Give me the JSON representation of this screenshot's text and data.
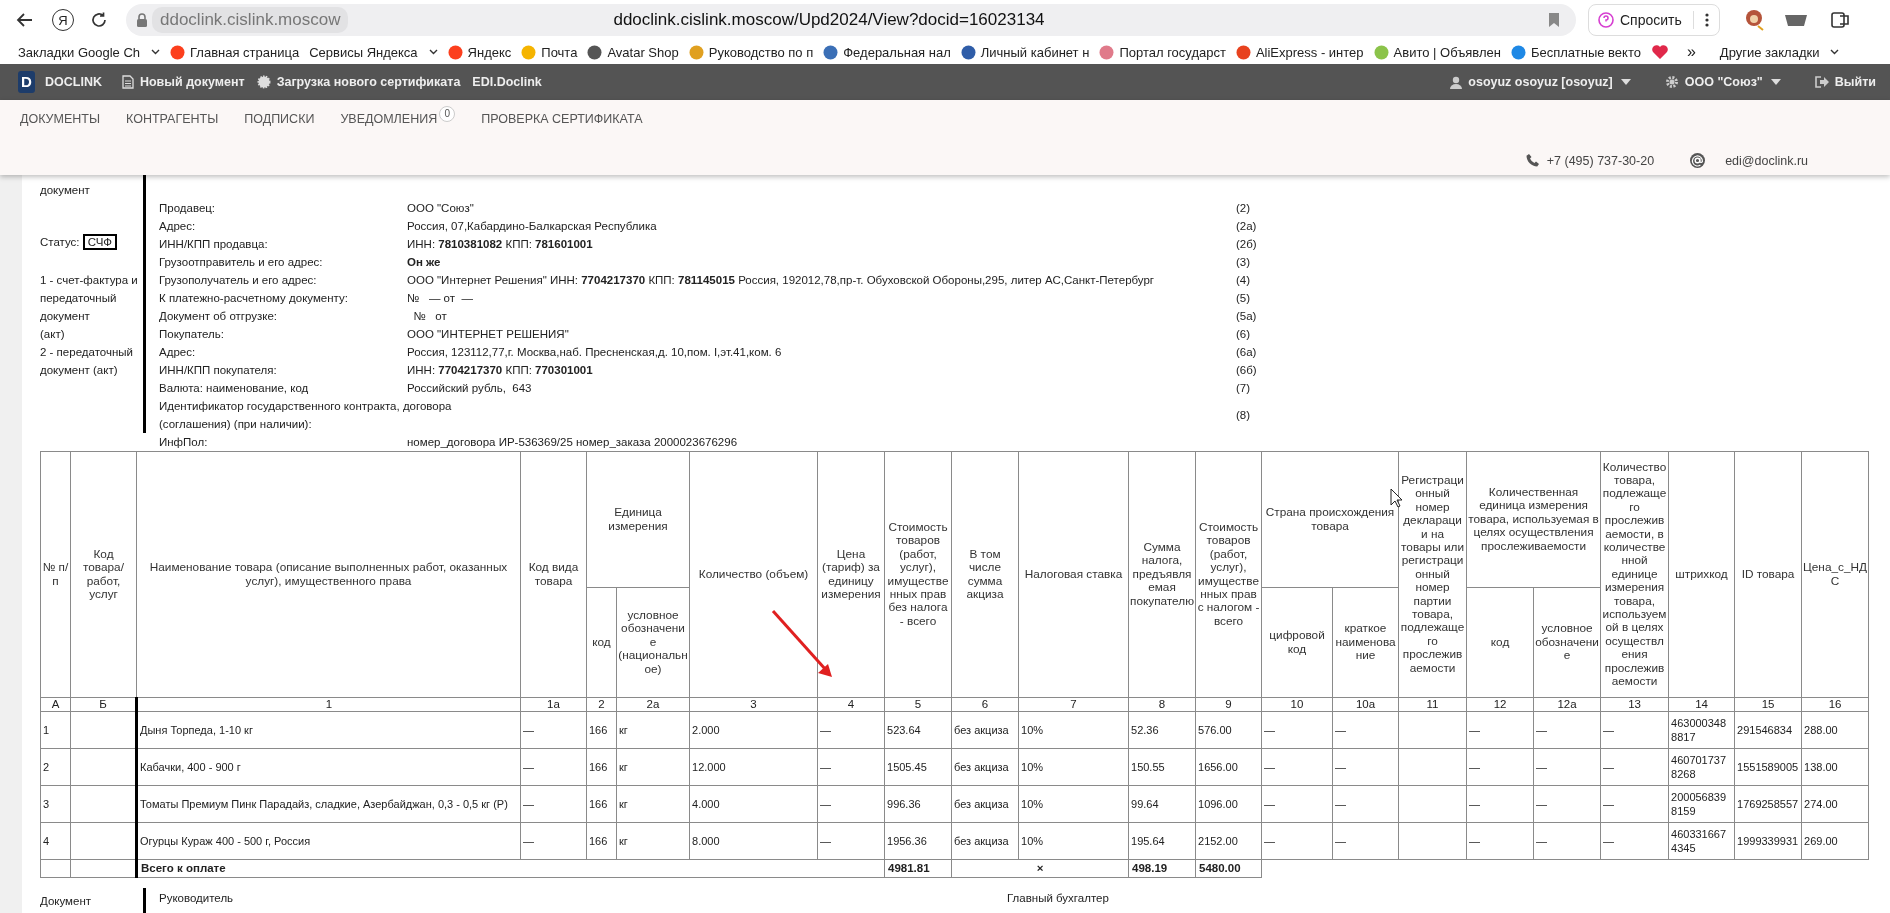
{
  "browser": {
    "yandex_button": "Я",
    "site_chip": "ddoclink.cislink.moscow",
    "url": "ddoclink.cislink.moscow/Upd2024/View?docid=16023134",
    "ask_button": "Спросить",
    "bookmarks": [
      {
        "kind": "menu",
        "label": "Закладки Google Ch"
      },
      {
        "kind": "site",
        "label": "Главная страница",
        "color": "#fc3f1d"
      },
      {
        "kind": "menu",
        "label": "Сервисы Яндекса"
      },
      {
        "kind": "site",
        "label": "Яндекс",
        "color": "#fc3f1d"
      },
      {
        "kind": "site",
        "label": "Почта",
        "color": "#f5b400"
      },
      {
        "kind": "site",
        "label": "Avatar Shop",
        "color": "#555555"
      },
      {
        "kind": "site",
        "label": "Руководство по п",
        "color": "#e0a020"
      },
      {
        "kind": "site",
        "label": "Федеральная нал",
        "color": "#3b6fb6"
      },
      {
        "kind": "site",
        "label": "Личный кабинет н",
        "color": "#2f5da8"
      },
      {
        "kind": "site",
        "label": "Портал государст",
        "color": "#e07a8a"
      },
      {
        "kind": "site",
        "label": "AliExpress - интер",
        "color": "#e8421e"
      },
      {
        "kind": "site",
        "label": "Авито | Объявлен",
        "color": "#8bc34a"
      },
      {
        "kind": "site",
        "label": "Бесплатные векто",
        "color": "#1e88e5"
      },
      {
        "kind": "icon",
        "color": "#e0284a"
      }
    ],
    "more": "»",
    "other_bookmarks": "Другие закладки"
  },
  "appbar": {
    "logo_letter": "D",
    "brand": "DOCLINK",
    "menu": [
      {
        "kind": "document",
        "label": "Новый документ"
      },
      {
        "kind": "certificate",
        "label": "Загрузка нового сертификата"
      },
      {
        "kind": "plain",
        "label": "EDI.Doclink"
      }
    ],
    "user": "osoyuz osoyuz [osoyuz]",
    "organization": "ООО \"Союз\"",
    "logout": "Выйти"
  },
  "nav": {
    "items": [
      {
        "label": "ДОКУМЕНТЫ"
      },
      {
        "label": "КОНТРАГЕНТЫ"
      },
      {
        "label": "ПОДПИСКИ"
      },
      {
        "label": "УВЕДОМЛЕНИЯ",
        "badge": "0"
      },
      {
        "label": "ПРОВЕРКА СЕРТИФИКАТА"
      }
    ],
    "phone": "+7 (495) 737-30-20",
    "email": "edi@doclink.ru"
  },
  "document": {
    "left_caption": "документ",
    "status_label": "Статус:",
    "status_value": "СЧФ",
    "legend": [
      "1 - счет-фактура и\nпередаточный\nдокумент\n(акт)",
      "2 - передаточный\nдокумент (акт)"
    ],
    "fields": [
      {
        "label": "Продавец:",
        "value": "ООО \"Союз\"",
        "code": "(2)",
        "bold": false
      },
      {
        "label": "Адрес:",
        "value": "Россия, 07,Кабардино-Балкарская Республика",
        "code": "(2а)",
        "bold": false
      },
      {
        "label": "ИНН/КПП продавца:",
        "value": "ИНН: **7810381082** КПП: **781601001**",
        "code": "(2б)",
        "bold": false
      },
      {
        "label": "Грузоотправитель и его адрес:",
        "value": "Он же",
        "code": "(3)",
        "bold": true
      },
      {
        "label": "Грузополучатель и его адрес:",
        "value": "ООО \"Интернет Решения\" ИНН: **7704217370** КПП: **781145015** Россия, 192012,78,пр-т. Обуховской Обороны,295, литер АС,Санкт-Петербург",
        "code": "(4)",
        "bold": false
      },
      {
        "label": "К платежно-расчетному документу:",
        "value": "№   — от  —",
        "code": "(5)",
        "bold": false
      },
      {
        "label": "Документ об отгрузке:",
        "value": "  №   от",
        "code": "(5а)",
        "bold": false
      },
      {
        "label": "Покупатель:",
        "value": "ООО \"ИНТЕРНЕТ РЕШЕНИЯ\"",
        "code": "(6)",
        "bold": false
      },
      {
        "label": "Адрес:",
        "value": "Россия, 123112,77,г. Москва,наб. Пресненская,д. 10,пом. I,эт.41,ком. 6",
        "code": "(6а)",
        "bold": false
      },
      {
        "label": "ИНН/КПП покупателя:",
        "value": "ИНН: **7704217370** КПП: **770301001**",
        "code": "(6б)",
        "bold": false
      },
      {
        "label": "Валюта: наименование, код",
        "value": "Российский рубль,  643",
        "code": "(7)",
        "bold": false
      },
      {
        "label": "Идентификатор государственного контракта, договора (соглашения) (при наличии):",
        "code": "(8)",
        "bold": false
      }
    ],
    "info_line": {
      "label": "ИнфПол:",
      "value": "номер_договора ИР-536369/25 номер_заказа 2000023676296"
    }
  },
  "table": {
    "header_rows": [
      [
        {
          "text": "№ п/п",
          "rowspan": 2
        },
        {
          "text": "Код товара/ работ, услуг",
          "rowspan": 2
        },
        {
          "text": "Наименование товара (описание выполненных работ, оказанных услуг), имущественного права",
          "rowspan": 2
        },
        {
          "text": "Код вида товара",
          "rowspan": 2
        },
        {
          "text": "Единица измерения",
          "colspan": 2
        },
        {
          "text": "Количество (объем)",
          "rowspan": 2
        },
        {
          "text": "Цена (тариф) за единицу измерения",
          "rowspan": 2
        },
        {
          "text": "Стоимость товаров (работ, услуг), имущественных прав без налога - всего",
          "rowspan": 2
        },
        {
          "text": "В том числе сумма акциза",
          "rowspan": 2
        },
        {
          "text": "Налоговая ставка",
          "rowspan": 2
        },
        {
          "text": "Сумма налога, предъявляемая покупателю",
          "rowspan": 2
        },
        {
          "text": "Стоимость товаров (работ, услуг), имущественных прав с налогом - всего",
          "rowspan": 2
        },
        {
          "text": "Страна происхождения товара",
          "colspan": 2
        },
        {
          "text": "Регистрационный номер декларации на товары или регистрационный номер партии товара, подлежащего прослеживаемости",
          "rowspan": 2
        },
        {
          "text": "Количественная единица измерения товара, используемая в целях осуществления прослеживаемости",
          "colspan": 2
        },
        {
          "text": "Количество товара, подлежащего прослеживаемости, в количественной единице измерения товара, используемой в целях осуществления прослеживаемости",
          "rowspan": 2
        },
        {
          "text": "штрихкод",
          "rowspan": 2
        },
        {
          "text": "ID товара",
          "rowspan": 2
        },
        {
          "text": "Цена_с_НДС",
          "rowspan": 2
        }
      ],
      [
        {
          "text": "код"
        },
        {
          "text": "условное обозначение (национальное)"
        },
        {
          "text": "цифровой код"
        },
        {
          "text": "краткое наименование"
        },
        {
          "text": "код"
        },
        {
          "text": "условное обозначение"
        }
      ]
    ],
    "number_row": [
      "А",
      "Б",
      "1",
      "1а",
      "2",
      "2а",
      "3",
      "4",
      "5",
      "6",
      "7",
      "8",
      "9",
      "10",
      "10а",
      "11",
      "12",
      "12а",
      "13",
      "14",
      "15",
      "16"
    ],
    "rows": [
      {
        "cells": [
          "1",
          null,
          "Дыня Торпеда, 1-10 кг",
          "—",
          "166",
          "кг",
          "2.000",
          "—",
          "523.64",
          "без акциза",
          "10%",
          "52.36",
          "576.00",
          "—",
          "—",
          null,
          "—",
          "—",
          "—",
          "4630003488817",
          "291546834",
          "288.00"
        ]
      },
      {
        "cells": [
          "2",
          null,
          "Кабачки, 400 - 900 г",
          "—",
          "166",
          "кг",
          "12.000",
          "—",
          "1505.45",
          "без акциза",
          "10%",
          "150.55",
          "1656.00",
          "—",
          "—",
          null,
          "—",
          "—",
          "—",
          "4607017378268",
          "1551589005",
          "138.00"
        ]
      },
      {
        "cells": [
          "3",
          null,
          "Томаты Премиум Пинк Парадайз, сладкие, Азербайджан, 0,3 - 0,5 кг (Р)",
          "—",
          "166",
          "кг",
          "4.000",
          "—",
          "996.36",
          "без акциза",
          "10%",
          "99.64",
          "1096.00",
          "—",
          "—",
          null,
          "—",
          "—",
          "—",
          "2000568398159",
          "1769258557",
          "274.00"
        ]
      },
      {
        "cells": [
          "4",
          null,
          "Огурцы Кураж 400 - 500 г, Россия",
          "—",
          "166",
          "кг",
          "8.000",
          "—",
          "1956.36",
          "без акциза",
          "10%",
          "195.64",
          "2152.00",
          "—",
          "—",
          null,
          "—",
          "—",
          "—",
          "4603316674345",
          "1999339931",
          "269.00"
        ]
      }
    ],
    "total_row": [
      {
        "kind": "empty"
      },
      {
        "kind": "empty"
      },
      {
        "kind": "label",
        "text": "Всего к оплате",
        "colspan": 6
      },
      {
        "kind": "amount",
        "text": "4981.81"
      },
      {
        "kind": "sign",
        "text": "×",
        "colspan": 2
      },
      {
        "kind": "amount",
        "text": "498.19"
      },
      {
        "kind": "amount",
        "text": "5480.00"
      }
    ]
  },
  "signatures": {
    "left_caption": "Документ",
    "head": "Руководитель",
    "accountant": "Главный бухгалтер"
  }
}
